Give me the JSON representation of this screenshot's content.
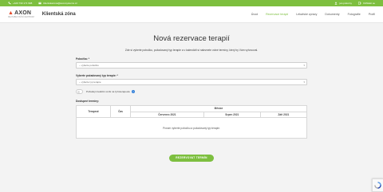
{
  "topbar": {
    "phone": "+420 733 171 998",
    "email": "klientskazona@axonsystems.cz",
    "account": "jan.pokorny",
    "logout": "Odhlásit se"
  },
  "header": {
    "logo_text": "AXON",
    "logo_subtitle": "RE-HABILITAČNÍ CENTRUM",
    "zone_title": "Klientská zóna",
    "nav": [
      {
        "label": "Úvod",
        "active": false
      },
      {
        "label": "Rezervace terapií",
        "active": true
      },
      {
        "label": "Lékařské zprávy",
        "active": false
      },
      {
        "label": "Dokumenty",
        "active": false
      },
      {
        "label": "Fotografie",
        "active": false
      },
      {
        "label": "Profil",
        "active": false
      }
    ]
  },
  "main": {
    "title": "Nová rezervace terapií",
    "intro": "Zde si vyberte pobočku, požadovaný typ terapie a v kalendáři si naleznete volné termíny, který by Vám vyhovoval.",
    "branch_label": "Pobočka: *",
    "branch_value": "-- vyberte pobočku",
    "therapy_label": "Vyberte požadovaný typ terapie: *",
    "therapy_value": "-- vyberte typ terapie",
    "wheelchair_label": "Požaduji invalidní vozík na fyzioterapeutu",
    "available_label": "Dostupné termíny:",
    "table": {
      "col_therapist": "Terapeut",
      "col_time": "Čas",
      "col_month": "Měsíce",
      "months": [
        "Červenec 2021",
        "Srpen 2021",
        "Září 2021"
      ],
      "empty_message": "Prosím vyberte pobočku a požadovaný typ terapie."
    },
    "submit_label": "REZERVOVAT TERMÍN"
  },
  "colors": {
    "accent": "#7dbf3f",
    "logo_accent": "#e24a2b",
    "info": "#2f7ed8"
  }
}
